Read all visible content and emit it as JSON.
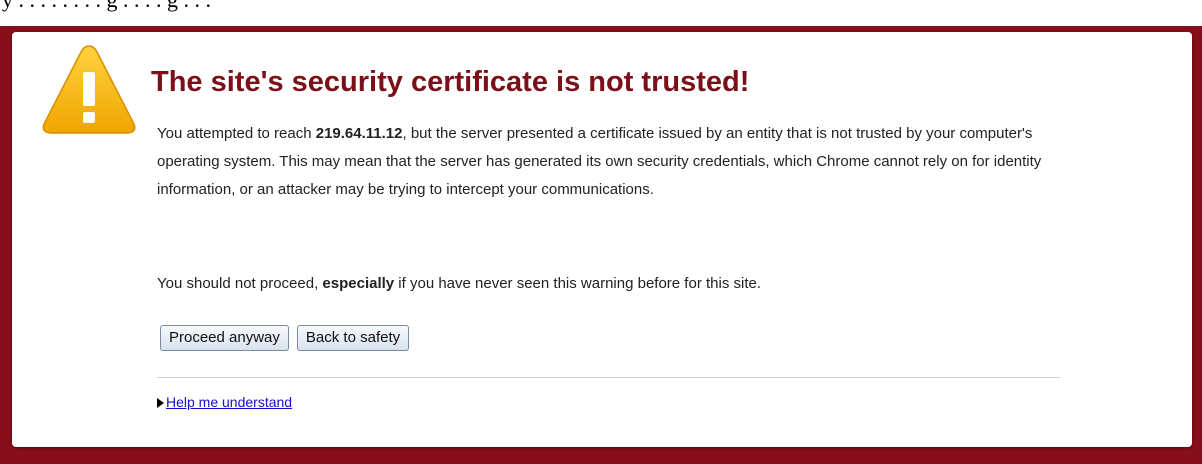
{
  "top_strip": {
    "text": "y . . . . . . . . g . . . . g . . ."
  },
  "warning": {
    "icon": "warning-triangle-icon",
    "title": "The site's security certificate is not trusted!",
    "para1_before": "You attempted to reach ",
    "host": "219.64.11.12",
    "para1_after": ", but the server presented a certificate issued by an entity that is not trusted by your computer's operating system. This may mean that the server has generated its own security credentials, which Chrome cannot rely on for identity information, or an attacker may be trying to intercept your communications.",
    "para2_before": "You should not proceed, ",
    "para2_emphasis": "especially",
    "para2_after": " if you have never seen this warning before for this site."
  },
  "buttons": {
    "proceed_label": "Proceed anyway",
    "back_label": "Back to safety"
  },
  "help": {
    "link_label": "Help me understand"
  },
  "colors": {
    "background": "#870f1c",
    "title": "#7b1018",
    "link": "#1a0dcc",
    "icon_fill": "#f5b400"
  }
}
